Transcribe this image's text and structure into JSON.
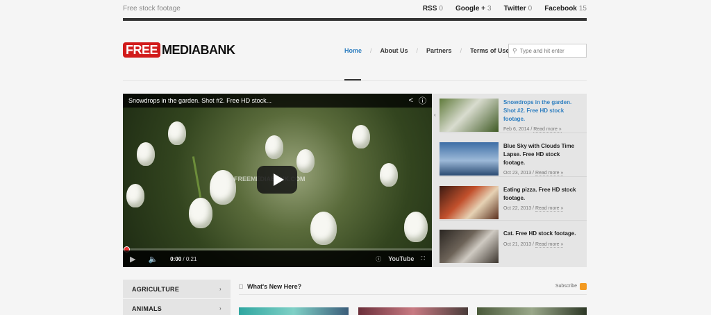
{
  "topbar": {
    "tagline": "Free stock footage",
    "social": [
      {
        "name": "RSS",
        "count": "0"
      },
      {
        "name": "Google +",
        "count": "3"
      },
      {
        "name": "Twitter",
        "count": "0"
      },
      {
        "name": "Facebook",
        "count": "15"
      }
    ]
  },
  "logo": {
    "free": "FREE",
    "bank": "MEDIABANK"
  },
  "nav": [
    "Home",
    "About Us",
    "Partners",
    "Terms of Use"
  ],
  "search": {
    "placeholder": "Type and hit enter"
  },
  "video": {
    "title": "Snowdrops in the garden. Shot #2. Free HD stock...",
    "watermark": "FREEMEDIABANK.COM",
    "time_current": "0:00",
    "time_total": "/ 0:21",
    "brand": "YouTube"
  },
  "video_list": [
    {
      "title": "Snowdrops in the garden. Shot #2. Free HD stock footage.",
      "date": "Feb 6, 2014",
      "more": "Read more »"
    },
    {
      "title": "Blue Sky with Clouds Time Lapse. Free HD stock footage.",
      "date": "Oct 23, 2013",
      "more": "Read more »"
    },
    {
      "title": "Eating pizza. Free HD stock footage.",
      "date": "Oct 22, 2013",
      "more": "Read more »"
    },
    {
      "title": "Cat. Free HD stock footage.",
      "date": "Oct 21, 2013",
      "more": "Read more »"
    }
  ],
  "categories": [
    "AGRICULTURE",
    "ANIMALS"
  ],
  "whats_new": {
    "title": "What's New Here?",
    "subscribe": "Subscribe"
  },
  "colors": {
    "accent": "#2f7fc0",
    "logo_red": "#d11a1a",
    "rss_orange": "#f39a21"
  }
}
